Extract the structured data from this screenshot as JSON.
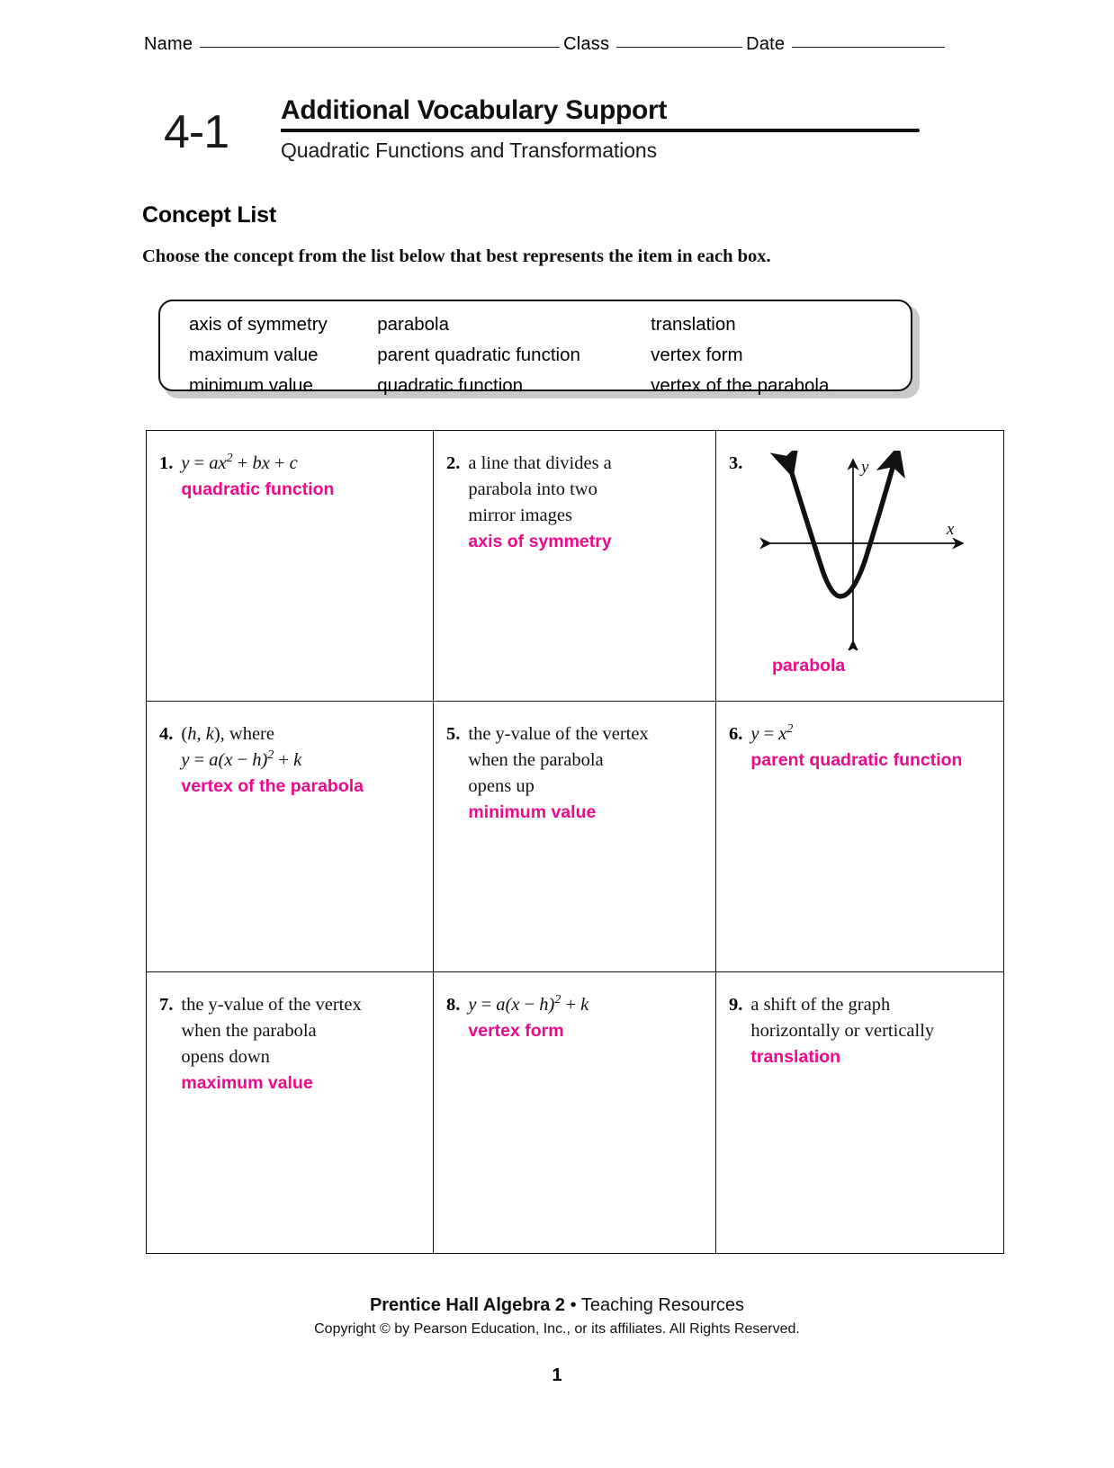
{
  "header": {
    "name_label": "Name",
    "class_label": "Class",
    "date_label": "Date"
  },
  "lesson": {
    "number": "4-1",
    "title": "Additional Vocabulary Support",
    "subtitle": "Quadratic Functions and Transformations"
  },
  "concept_list": {
    "heading": "Concept List",
    "instruction": "Choose the concept from the list below that best represents the item in each box.",
    "terms": {
      "row1": [
        "axis of symmetry",
        "parabola",
        "translation"
      ],
      "row2": [
        "maximum value",
        "parent quadratic function",
        "vertex form"
      ],
      "row3": [
        "minimum value",
        "quadratic function",
        "vertex of the parabola"
      ]
    }
  },
  "items": [
    {
      "number": "1.",
      "prompt_math": "y = ax2 + bx + c",
      "answer": "quadratic function"
    },
    {
      "number": "2.",
      "prompt_line1": "a line that divides a",
      "prompt_line2": "parabola into two",
      "prompt_line3": "mirror images",
      "answer": "axis of symmetry"
    },
    {
      "number": "3.",
      "graph": {
        "x_axis_label": "x",
        "y_axis_label": "y"
      },
      "answer": "parabola"
    },
    {
      "number": "4.",
      "prompt_line1": "(h, k), where",
      "prompt_math": "y = a(x - h)2 + k",
      "answer": "vertex of the parabola"
    },
    {
      "number": "5.",
      "prompt_line1": "the y-value of the vertex",
      "prompt_line2": "when the parabola",
      "prompt_line3": "opens up",
      "answer": "minimum value"
    },
    {
      "number": "6.",
      "prompt_math": "y = x2",
      "answer": "parent quadratic function"
    },
    {
      "number": "7.",
      "prompt_line1": "the y-value of the vertex",
      "prompt_line2": "when the parabola",
      "prompt_line3": "opens down",
      "answer": "maximum value"
    },
    {
      "number": "8.",
      "prompt_math": "y = a(x - h)2 + k",
      "answer": "vertex form"
    },
    {
      "number": "9.",
      "prompt_line1": "a shift of the graph",
      "prompt_line2": "horizontally or vertically",
      "answer": "translation"
    }
  ],
  "footer": {
    "book": "Prentice Hall Algebra 2",
    "separator": "•",
    "resource": "Teaching Resources",
    "copyright": "Copyright © by Pearson Education, Inc., or its affiliates. All Rights Reserved.",
    "page_number": "1"
  },
  "colors": {
    "answer_ink": "#ec0a8c",
    "rule_ink": "#111111"
  }
}
